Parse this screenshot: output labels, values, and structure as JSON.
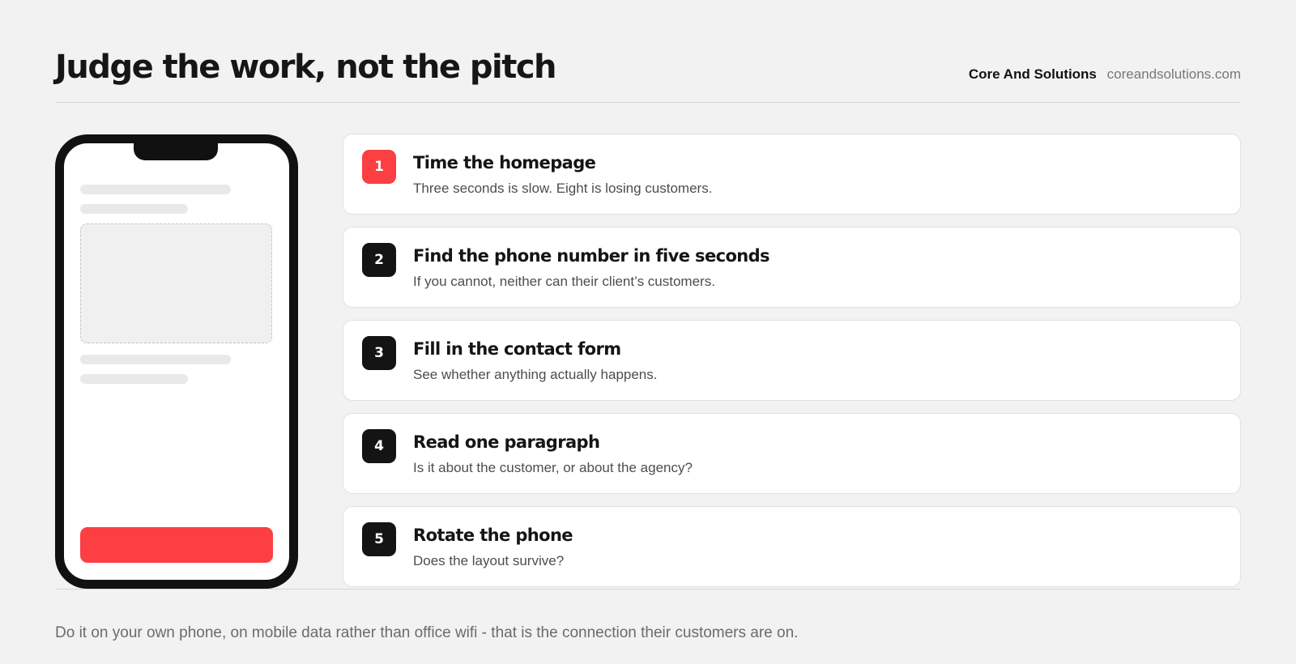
{
  "header": {
    "title": "Judge the work, not the pitch",
    "brand_name": "Core And Solutions",
    "brand_url": "coreandsolutions.com"
  },
  "steps": [
    {
      "number": "1",
      "title": "Time the homepage",
      "description": "Three seconds is slow. Eight is losing customers."
    },
    {
      "number": "2",
      "title": "Find the phone number in five seconds",
      "description": "If you cannot, neither can their client’s customers."
    },
    {
      "number": "3",
      "title": "Fill in the contact form",
      "description": "See whether anything actually happens."
    },
    {
      "number": "4",
      "title": "Read one paragraph",
      "description": "Is it about the customer, or about the agency?"
    },
    {
      "number": "5",
      "title": "Rotate the phone",
      "description": "Does the layout survive?"
    }
  ],
  "footer": {
    "note": "Do it on your own phone, on mobile data rather than office wifi - that is the connection their customers are on."
  },
  "colors": {
    "accent": "#fc3f42",
    "badge_dark": "#141414",
    "background": "#f2f2f2",
    "card": "#ffffff"
  }
}
